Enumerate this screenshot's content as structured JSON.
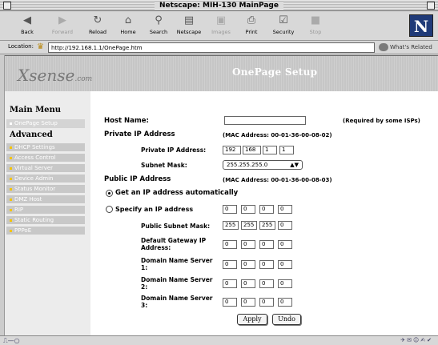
{
  "window": {
    "title": "Netscape: MIH-130 MainPage"
  },
  "toolbar": {
    "buttons": [
      {
        "label": "Back",
        "icon": "back-arrow-icon",
        "enabled": true
      },
      {
        "label": "Forward",
        "icon": "forward-arrow-icon",
        "enabled": false
      },
      {
        "label": "Reload",
        "icon": "reload-icon",
        "enabled": true
      },
      {
        "label": "Home",
        "icon": "home-icon",
        "enabled": true
      },
      {
        "label": "Search",
        "icon": "search-icon",
        "enabled": true
      },
      {
        "label": "Netscape",
        "icon": "netscape-icon",
        "enabled": true
      },
      {
        "label": "Images",
        "icon": "images-icon",
        "enabled": false
      },
      {
        "label": "Print",
        "icon": "print-icon",
        "enabled": true
      },
      {
        "label": "Security",
        "icon": "security-lock-icon",
        "enabled": true
      },
      {
        "label": "Stop",
        "icon": "stop-icon",
        "enabled": false
      }
    ],
    "logo": "N"
  },
  "location": {
    "label": "Location:",
    "url": "http://192.168.1.1/OnePage.htm",
    "related": "What's Related"
  },
  "header": {
    "logo_text": "Xsense",
    "logo_suffix": ".com",
    "page_title": "OnePage Setup"
  },
  "sidebar": {
    "main_menu": "Main Menu",
    "current": "OnePage Setup",
    "advanced": "Advanced",
    "items": [
      "DHCP Settings",
      "Access Control",
      "Virtual Server",
      "Device Admin",
      "Status Monitor",
      "DMZ Host",
      "RIP",
      "Static Routing",
      "PPPoE"
    ]
  },
  "form": {
    "host_name": {
      "label": "Host Name:",
      "value": "",
      "note": "(Required by some ISPs)"
    },
    "private": {
      "title": "Private IP Address",
      "mac": "(MAC Address: 00-01-36-00-08-02)",
      "ip_label": "Private IP Address:",
      "ip": [
        "192",
        "168",
        "1",
        "1"
      ],
      "mask_label": "Subnet Mask:",
      "mask_value": "255.255.255.0"
    },
    "public": {
      "title": "Public IP Address",
      "mac": "(MAC Address: 00-01-36-00-08-03)",
      "auto_label": "Get an IP address automatically",
      "specify_label": "Specify an IP address",
      "selected": "auto",
      "ip": [
        "0",
        "0",
        "0",
        "0"
      ],
      "mask_label": "Public Subnet Mask:",
      "mask": [
        "255",
        "255",
        "255",
        "0"
      ],
      "gateway_label": "Default Gateway IP Address:",
      "gateway": [
        "0",
        "0",
        "0",
        "0"
      ],
      "dns1_label": "Domain Name Server 1:",
      "dns1": [
        "0",
        "0",
        "0",
        "0"
      ],
      "dns2_label": "Domain Name Server 2:",
      "dns2": [
        "0",
        "0",
        "0",
        "0"
      ],
      "dns3_label": "Domain Name Server 3:",
      "dns3": [
        "0",
        "0",
        "0",
        "0"
      ]
    },
    "apply_label": "Apply",
    "undo_label": "Undo"
  }
}
